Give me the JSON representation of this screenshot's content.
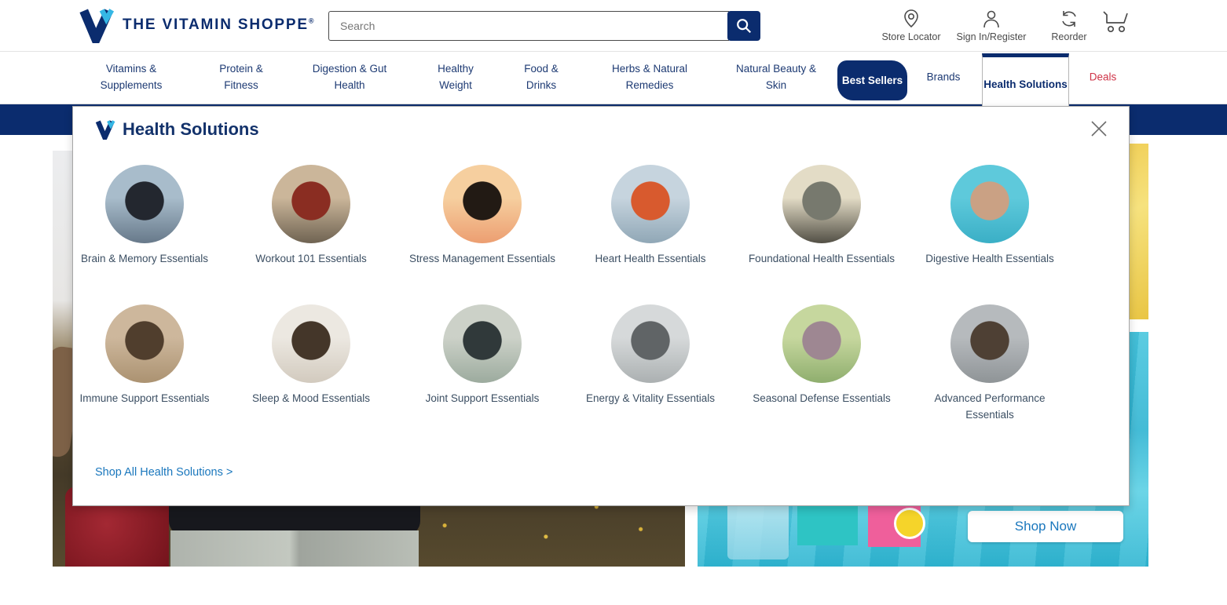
{
  "brand": {
    "name": "THE VITAMIN SHOPPE",
    "reg_mark": "®",
    "colors": {
      "navy": "#0b2c6e",
      "light_blue": "#35b7e5",
      "deals_red": "#cf3347",
      "link_blue": "#1a77bd"
    }
  },
  "header": {
    "search": {
      "placeholder": "Search",
      "value": "",
      "button_icon": "search-icon"
    },
    "utility": [
      {
        "label": "Store Locator",
        "icon": "location-pin-icon"
      },
      {
        "label": "Sign In/Register",
        "icon": "person-icon"
      },
      {
        "label": "Reorder",
        "icon": "refresh-icon"
      }
    ],
    "cart": {
      "icon": "cart-icon"
    }
  },
  "nav": {
    "items": [
      {
        "label": "Vitamins & Supplements"
      },
      {
        "label": "Protein & Fitness"
      },
      {
        "label": "Digestion & Gut Health"
      },
      {
        "label": "Healthy Weight"
      },
      {
        "label": "Food & Drinks"
      },
      {
        "label": "Herbs & Natural Remedies"
      },
      {
        "label": "Natural Beauty & Skin"
      },
      {
        "label": "Best Sellers",
        "style": "pill"
      },
      {
        "label": "Brands"
      },
      {
        "label": "Health Solutions",
        "active": true
      },
      {
        "label": "Deals",
        "style": "red"
      }
    ]
  },
  "menu": {
    "title": "Health Solutions",
    "logo_icon": "vitamin-shoppe-v-icon",
    "close_icon": "close-icon",
    "shop_all_label": "Shop All Health Solutions >",
    "items": [
      {
        "label": "Brain & Memory Essentials",
        "photo": "man-in-glasses-at-screen",
        "photo_colors": [
          "#a8bccb",
          "#23272f",
          "#67798a"
        ]
      },
      {
        "label": "Workout 101 Essentials",
        "photo": "man-lifting-dumbbell",
        "photo_colors": [
          "#cbb69a",
          "#8a2d22",
          "#6f6352"
        ]
      },
      {
        "label": "Stress Management Essentials",
        "photo": "yoga-silhouette-at-sunset",
        "photo_colors": [
          "#f6cf9f",
          "#221a14",
          "#ec9e71"
        ]
      },
      {
        "label": "Heart Health Essentials",
        "photo": "woman-checking-pulse",
        "photo_colors": [
          "#c6d4de",
          "#d85a2e",
          "#90a7b6"
        ]
      },
      {
        "label": "Foundational Health Essentials",
        "photo": "hiker-on-mountain-top",
        "photo_colors": [
          "#e3dcc6",
          "#77796e",
          "#524f45"
        ]
      },
      {
        "label": "Digestive Health Essentials",
        "photo": "man-eating-salad",
        "photo_colors": [
          "#5ec9db",
          "#caa184",
          "#3aafc6"
        ]
      },
      {
        "label": "Immune Support Essentials",
        "photo": "woman-blowing-nose",
        "photo_colors": [
          "#cdb79c",
          "#503e2d",
          "#ab9271"
        ]
      },
      {
        "label": "Sleep & Mood Essentials",
        "photo": "woman-sleeping-on-pillow",
        "photo_colors": [
          "#ece8e1",
          "#443629",
          "#d2cabe"
        ]
      },
      {
        "label": "Joint Support Essentials",
        "photo": "woman-stretching-outdoors",
        "photo_colors": [
          "#ccd1c8",
          "#30393a",
          "#9cab9e"
        ]
      },
      {
        "label": "Energy & Vitality Essentials",
        "photo": "man-on-treadmill",
        "photo_colors": [
          "#d6d9da",
          "#606466",
          "#abb0b1"
        ]
      },
      {
        "label": "Seasonal Defense Essentials",
        "photo": "man-sneezing-outdoors",
        "photo_colors": [
          "#c6d79e",
          "#9e8792",
          "#8fae6e"
        ]
      },
      {
        "label": "Advanced Performance Essentials",
        "photo": "man-doing-pushup",
        "photo_colors": [
          "#b6babd",
          "#4e4034",
          "#8f9497"
        ]
      }
    ]
  },
  "hero": {
    "shop_now_label": "Shop Now"
  }
}
